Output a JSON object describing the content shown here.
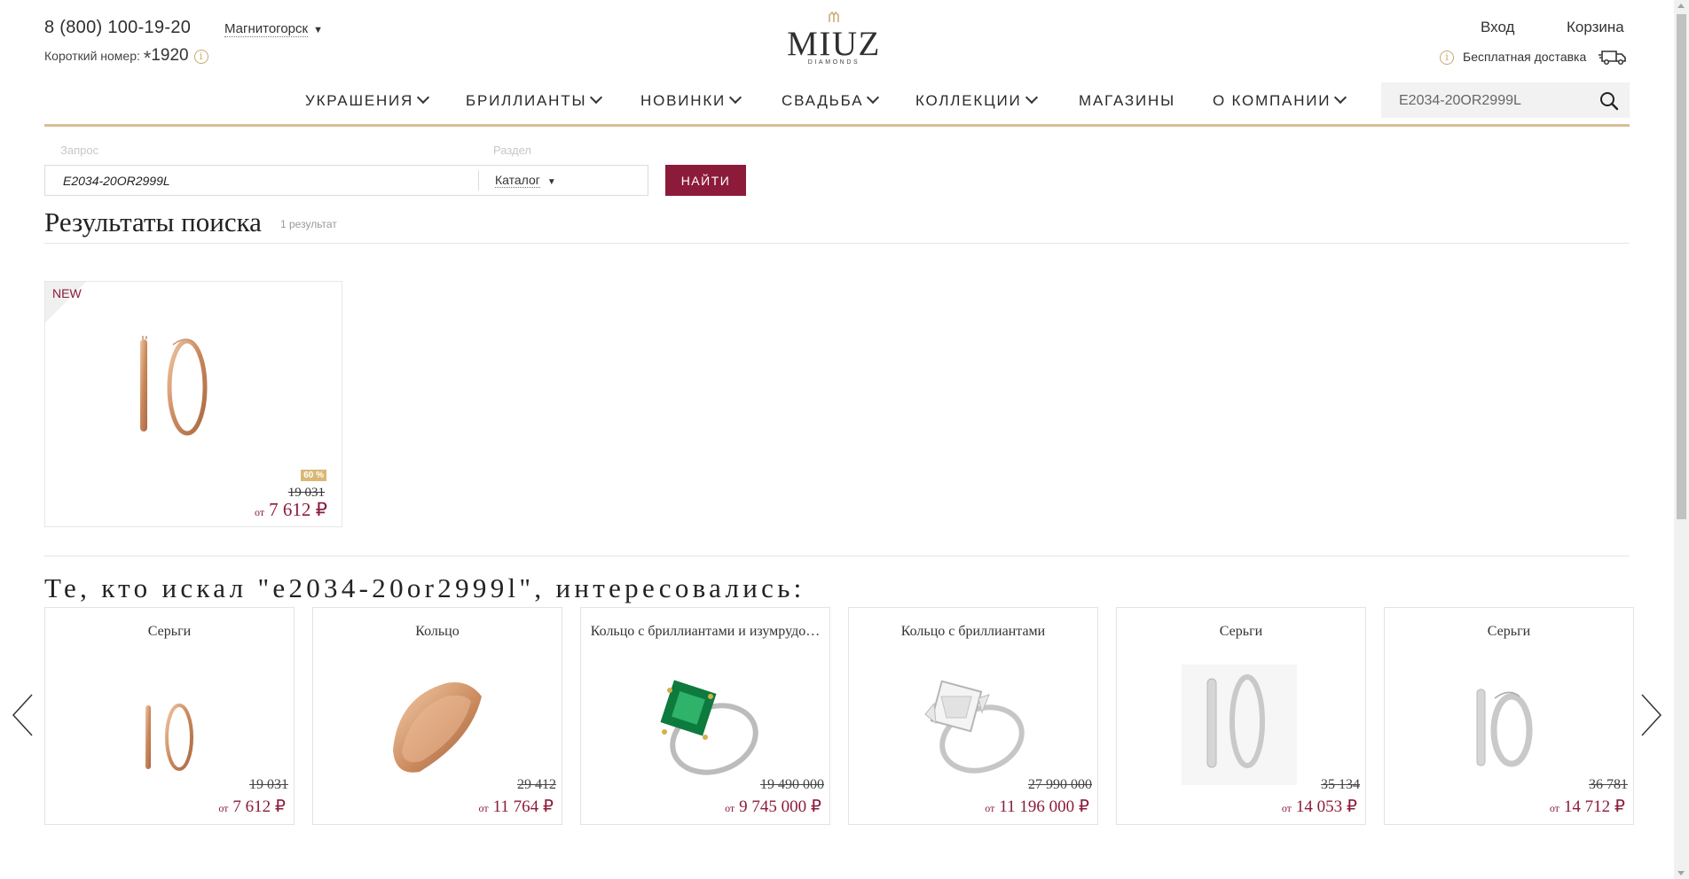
{
  "header": {
    "phone": "8 (800) 100-19-20",
    "city": "Магнитогорск",
    "short_label": "Короткий номер:",
    "short_star": "*",
    "short_number": "1920",
    "logo_word": "MIUZ",
    "logo_sub": "DIAMONDS",
    "login": "Вход",
    "cart": "Корзина",
    "delivery": "Бесплатная доставка"
  },
  "nav": {
    "items": [
      {
        "label": "УКРАШЕНИЯ"
      },
      {
        "label": "БРИЛЛИАНТЫ"
      },
      {
        "label": "НОВИНКИ"
      },
      {
        "label": "СВАДЬБА"
      },
      {
        "label": "КОЛЛЕКЦИИ"
      },
      {
        "label": "МАГАЗИНЫ"
      },
      {
        "label": "О КОМПАНИИ"
      }
    ],
    "search_value": "E2034-20OR2999L"
  },
  "search_form": {
    "query_label": "Запрос",
    "section_label": "Раздел",
    "query_value": "E2034-20OR2999L",
    "section_value": "Каталог",
    "button": "НАЙТИ"
  },
  "results": {
    "title": "Результаты поиска",
    "count": "1 результат",
    "product": {
      "badge": "NEW",
      "discount": "60 %",
      "old_price": "19 031",
      "price_prefix": "от",
      "price": "7 612 ₽"
    }
  },
  "recommendations": {
    "title": "Те, кто искал \"e2034-20or2999l\", интересовались:",
    "items": [
      {
        "name": "Серьги",
        "old": "19 031",
        "prefix": "от",
        "price": "7 612 ₽"
      },
      {
        "name": "Кольцо",
        "old": "29 412",
        "prefix": "от",
        "price": "11 764 ₽"
      },
      {
        "name": "Кольцо с бриллиантами и изумрудо…",
        "old": "19 490 000",
        "prefix": "от",
        "price": "9 745 000 ₽"
      },
      {
        "name": "Кольцо с бриллиантами",
        "old": "27 990 000",
        "prefix": "от",
        "price": "11 196 000 ₽"
      },
      {
        "name": "Серьги",
        "old": "35 134",
        "prefix": "от",
        "price": "14 053 ₽"
      },
      {
        "name": "Серьги",
        "old": "36 781",
        "prefix": "от",
        "price": "14 712 ₽"
      }
    ]
  },
  "colors": {
    "accent": "#8c1b3a",
    "gold": "#d8be97",
    "badge": "#d9b876"
  },
  "icons": [
    "info-icon",
    "truck-icon",
    "chevron-down-icon",
    "search-icon",
    "arrow-left-icon",
    "arrow-right-icon"
  ]
}
